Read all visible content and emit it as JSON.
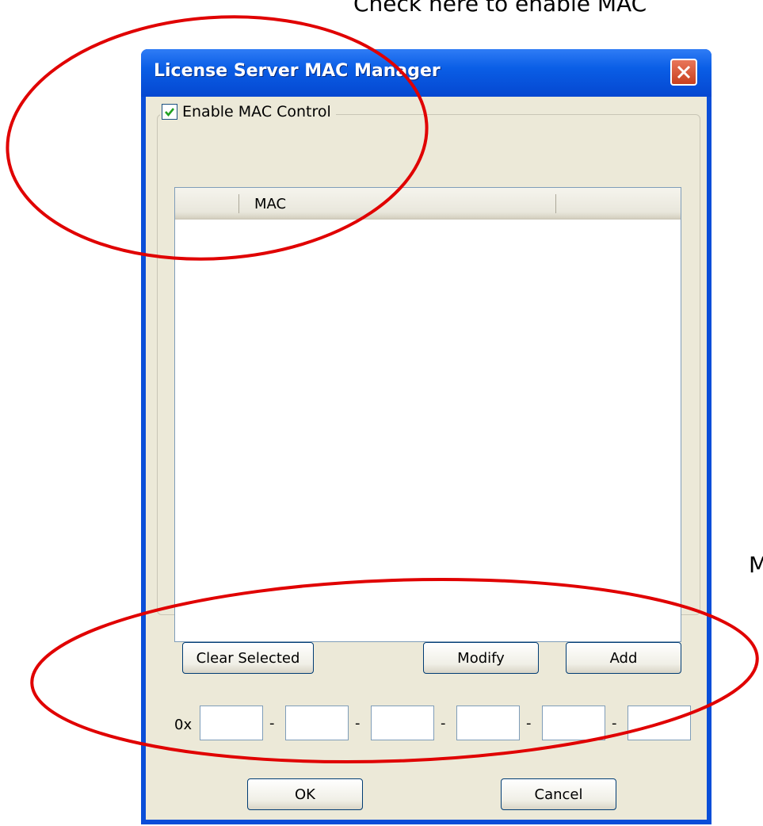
{
  "callouts": {
    "top": "Check here to enable MAC",
    "middle": "M"
  },
  "dialog": {
    "title": "License Server MAC Manager",
    "close_icon": "close-icon",
    "enable_mac_control": {
      "label": "Enable MAC Control",
      "checked": true
    },
    "list": {
      "columns": [
        "",
        "MAC",
        ""
      ],
      "rows": []
    },
    "buttons": {
      "clear_selected": "Clear Selected",
      "modify": "Modify",
      "add": "Add",
      "ok": "OK",
      "cancel": "Cancel"
    },
    "mac_input": {
      "prefix": "0x",
      "separator": "-",
      "fields": [
        "",
        "",
        "",
        "",
        "",
        ""
      ]
    }
  },
  "colors": {
    "titlebar": "#0a5ee6",
    "dialog_face": "#ece9d8",
    "annotation": "#e00000",
    "checkmark": "#21a121"
  }
}
